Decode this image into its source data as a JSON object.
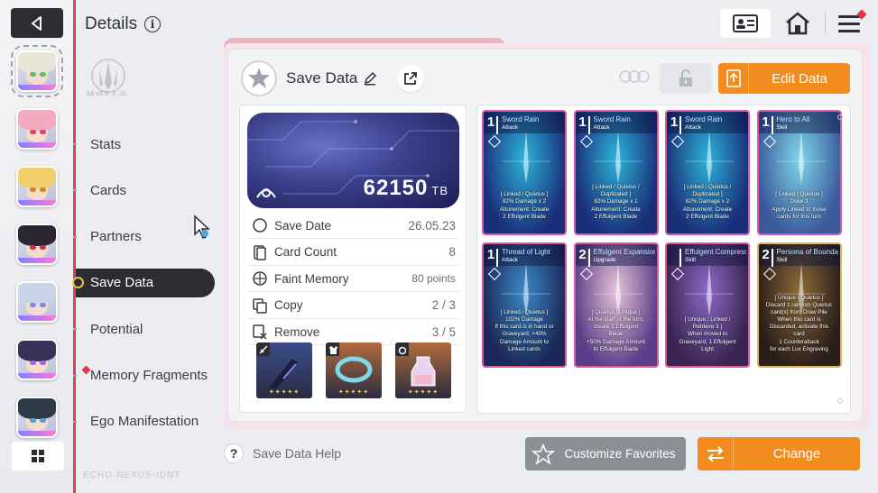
{
  "header": {
    "title": "Details",
    "info_icon": "info-icon",
    "id_card_icon": "id-card-icon",
    "home_icon": "home-icon",
    "menu_icon": "menu-icon"
  },
  "characters": [
    {
      "hair": "#e9e6d8",
      "eye": "#6ab86e",
      "selected": true
    },
    {
      "hair": "#f3a9be",
      "eye": "#d54770",
      "selected": false
    },
    {
      "hair": "#f2cf6b",
      "eye": "#c98a2b",
      "selected": false
    },
    {
      "hair": "#2a2530",
      "eye": "#b83a4a",
      "selected": false
    },
    {
      "hair": "#c9d4e8",
      "eye": "#7a8fd8",
      "selected": false
    },
    {
      "hair": "#36325a",
      "eye": "#9e6ad8",
      "selected": false
    },
    {
      "hair": "#2e3a48",
      "eye": "#58a0c8",
      "selected": false
    }
  ],
  "nav": {
    "emblem_text": "SEVEN·X·ID",
    "items": [
      {
        "label": "Stats",
        "active": false,
        "alert": false
      },
      {
        "label": "Cards",
        "active": false,
        "alert": false
      },
      {
        "label": "Partners",
        "active": false,
        "alert": false
      },
      {
        "label": "Save Data",
        "active": true,
        "alert": false
      },
      {
        "label": "Potential",
        "active": false,
        "alert": false
      },
      {
        "label": "Memory Fragments",
        "active": false,
        "alert": true
      },
      {
        "label": "Ego Manifestation",
        "active": false,
        "alert": false
      }
    ],
    "footer_text": "ECHO-NEXUS-IDNT"
  },
  "save_data": {
    "title": "Save Data",
    "edit_label": "Edit Data",
    "tb_amount": "62150",
    "tb_unit": "TB",
    "stats": [
      {
        "label": "Save Date",
        "value": "26.05.23",
        "icon": "clock-icon"
      },
      {
        "label": "Card Count",
        "value": "8",
        "icon": "card-count-icon"
      },
      {
        "label": "Faint Memory",
        "value": "80 points",
        "icon": "faint-memory-icon"
      },
      {
        "label": "Copy",
        "value": "2 / 3",
        "icon": "copy-icon"
      },
      {
        "label": "Remove",
        "value": "3 / 5",
        "icon": "remove-icon"
      }
    ],
    "equipment": [
      {
        "name": "weapon",
        "bg": "#3a4d8c",
        "stars": "✦✦✦✦✦",
        "tag_icon": "sword-icon"
      },
      {
        "name": "armor",
        "bg": "#b26a3c",
        "stars": "✦✦✦✦✦",
        "tag_icon": "armor-icon"
      },
      {
        "name": "accessory",
        "bg": "#b26a3c",
        "stars": "✦✦✦✦✦",
        "tag_icon": "ring-icon"
      }
    ]
  },
  "cards": [
    {
      "cost": "1",
      "name": "Sword Rain",
      "type": "Attack",
      "desc": "[ Linked / Quietus ]\n82% Damage x 2\nAttunement: Create\n2 Effulgent Blade",
      "c1": "#2bb4d8",
      "c2": "#1a2e7a",
      "border": "#d85aa0"
    },
    {
      "cost": "1",
      "name": "Sword Rain",
      "type": "Attack",
      "desc": "[ Linked / Quietus /\nDuplicated ]\n82% Damage x 2\nAttunement: Create\n2 Effulgent Blade",
      "c1": "#2bb4d8",
      "c2": "#1a2e7a",
      "border": "#d85aa0"
    },
    {
      "cost": "1",
      "name": "Sword Rain",
      "type": "Attack",
      "desc": "[ Linked / Quietus /\nDuplicated ]\n82% Damage x 2\nAttunement: Create\n2 Effulgent Blade",
      "c1": "#2bb4d8",
      "c2": "#1a2e7a",
      "border": "#d85aa0"
    },
    {
      "cost": "1",
      "name": "Hero to All",
      "type": "Skill",
      "desc": "[ Linked / Quietus ]\nDraw 3\nApply Linked to those\ncards for this turn",
      "c1": "#7ed6e8",
      "c2": "#3b5a9c",
      "border": "#d85aa0"
    },
    {
      "cost": "1",
      "name": "Thread of Light",
      "type": "Attack",
      "desc": "[ Linked / Quietus ]\n102% Damage\nIf this card is in hand or\nGraveyard, +40%\nDamage Amount to\nLinked cards",
      "c1": "#3a8ac8",
      "c2": "#1b2756",
      "border": "#d85aa0"
    },
    {
      "cost": "2",
      "name": "Effulgent Expansion",
      "type": "Upgrade",
      "desc": "[ Quietus / Unique ]\nAt the start of the turn,\ncreate 2 Effulgent\nBlade\n+50% Damage Amount\nto Effulgent Blade",
      "c1": "#e6c2d8",
      "c2": "#5a3e8a",
      "border": "#d85aa0"
    },
    {
      "cost": "",
      "name": "Effulgent Compression",
      "type": "Skill",
      "desc": "[ Unique / Linked /\nRetrieve 3 ]\nWhen moved to\nGraveyard, 1 Effulgent\nLight",
      "c1": "#8a6ac8",
      "c2": "#3a2450",
      "border": "#d85aa0"
    },
    {
      "cost": "2",
      "name": "Persona of Boundary",
      "type": "Skill",
      "desc": "[ Unique / Quietus ]\nDiscard 1 random Quietus\ncard(s) from Draw Pile\nWhen this card is\nDiscarded, activate this\ncard\n1 Counterattack\nfor each Lux Engraving",
      "c1": "#8c6a3a",
      "c2": "#2a1e1a",
      "border": "#e0b25a"
    }
  ],
  "bottom": {
    "help_label": "Save Data Help",
    "favorites_label": "Customize Favorites",
    "change_label": "Change"
  },
  "colors": {
    "accent_orange": "#f28c1e",
    "accent_red": "#e3354c",
    "dark": "#2b2d33"
  }
}
